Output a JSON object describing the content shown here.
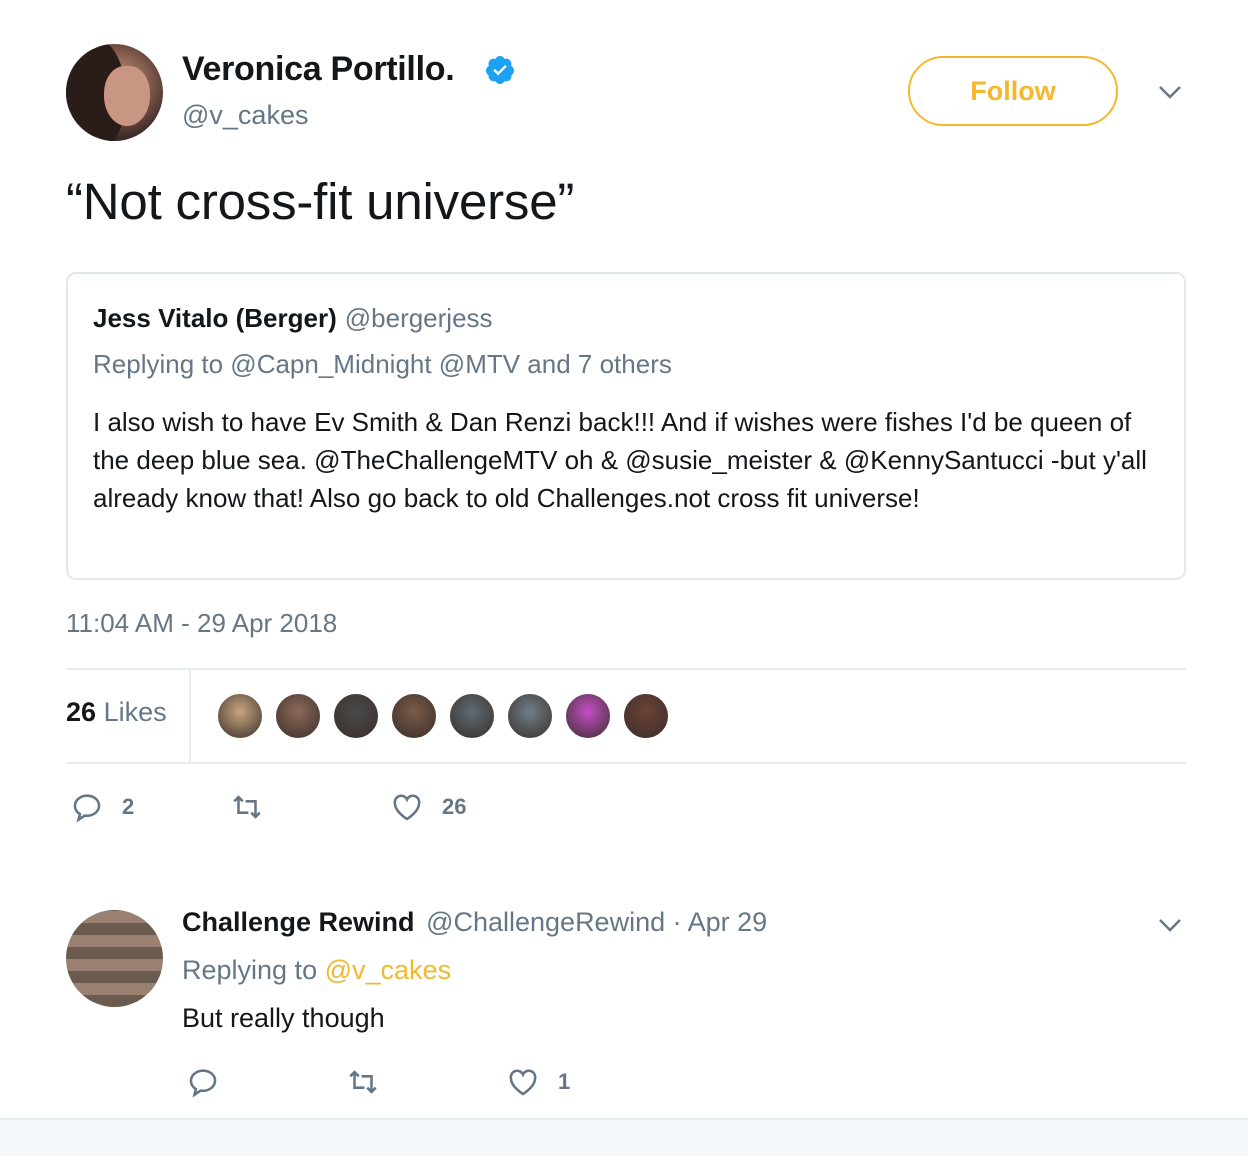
{
  "tweet": {
    "display_name": "Veronica Portillo.",
    "screen_name": "@v_cakes",
    "follow_label": "Follow",
    "text": "“Not cross-fit universe”",
    "timestamp": "11:04 AM - 29 Apr 2018",
    "likes_number": "26",
    "likes_label": "Likes",
    "reply_count": "2",
    "retweet_count": "",
    "like_count": "26"
  },
  "quote": {
    "name": "Jess Vitalo (Berger)",
    "handle": "@bergerjess",
    "replying": "Replying to @Capn_Midnight @MTV and 7 others",
    "body": "I also wish to have Ev Smith & Dan Renzi back!!! And if wishes were fishes I'd be queen of the deep blue sea. @TheChallengeMTV oh &  @susie_meister & @KennySantucci -but y'all already know that! Also go back to old Challenges.not cross fit universe!"
  },
  "likers": [
    {
      "name": "liker-1",
      "color": "#c9a67e"
    },
    {
      "name": "liker-2",
      "color": "#8c6a5a"
    },
    {
      "name": "liker-3",
      "color": "#4a4a4a"
    },
    {
      "name": "liker-4",
      "color": "#7a5a48"
    },
    {
      "name": "liker-5",
      "color": "#5d6b73"
    },
    {
      "name": "liker-6",
      "color": "#6f7f8a"
    },
    {
      "name": "liker-7",
      "color": "#c44fc6"
    },
    {
      "name": "liker-8",
      "color": "#6b4236"
    }
  ],
  "reply": {
    "name": "Challenge Rewind",
    "meta": "@ChallengeRewind · Apr 29",
    "replying_prefix": "Replying to",
    "replying_link": "@v_cakes",
    "text": "But really though",
    "reply_count": "",
    "retweet_count": "",
    "like_count": "1"
  },
  "colors": {
    "accent": "#f5b72b",
    "verified": "#1da1f2",
    "muted": "#657786"
  }
}
